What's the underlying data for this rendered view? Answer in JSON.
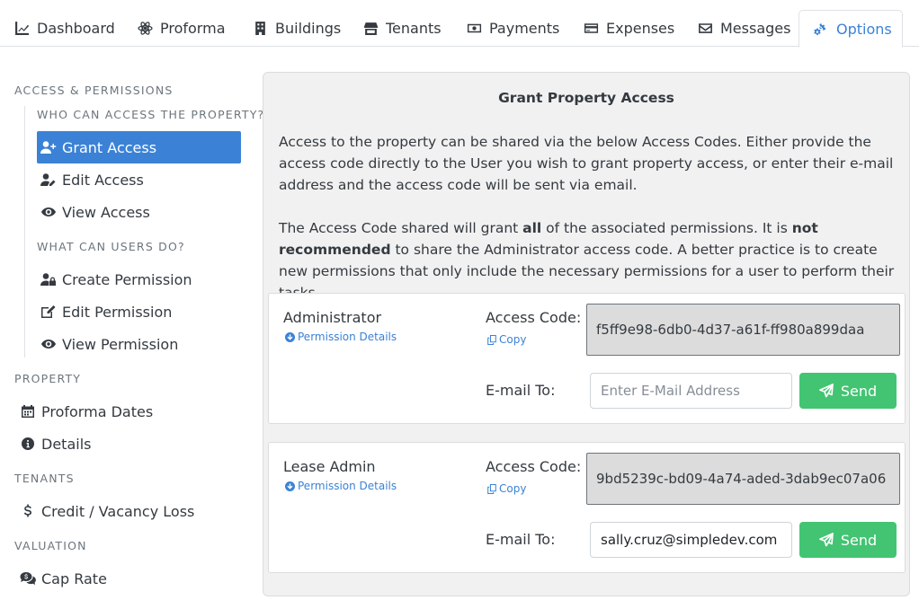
{
  "tabs": [
    {
      "label": "Dashboard",
      "icon": "chart-line-icon"
    },
    {
      "label": "Proforma",
      "icon": "atom-icon"
    },
    {
      "label": "Buildings",
      "icon": "building-icon"
    },
    {
      "label": "Tenants",
      "icon": "store-icon"
    },
    {
      "label": "Payments",
      "icon": "money-bill-icon"
    },
    {
      "label": "Expenses",
      "icon": "credit-card-icon"
    },
    {
      "label": "Messages",
      "icon": "envelope-icon"
    },
    {
      "label": "Options",
      "icon": "gears-icon",
      "active": true
    }
  ],
  "sidebar": {
    "access_heading": "ACCESS & PERMISSIONS",
    "who_heading": "WHO CAN ACCESS THE PROPERTY?",
    "grant_access": "Grant Access",
    "edit_access": "Edit Access",
    "view_access": "View Access",
    "what_heading": "WHAT CAN USERS DO?",
    "create_permission": "Create Permission",
    "edit_permission": "Edit Permission",
    "view_permission": "View Permission",
    "property_heading": "PROPERTY",
    "proforma_dates": "Proforma Dates",
    "details": "Details",
    "tenants_heading": "TENANTS",
    "credit_vacancy": "Credit / Vacancy Loss",
    "valuation_heading": "VALUATION",
    "cap_rate": "Cap Rate"
  },
  "main": {
    "title": "Grant Property Access",
    "intro": "Access to the property can be shared via the below Access Codes. Either provide the access code directly to the User you wish to grant property access, or enter their e-mail address and the access code will be sent via email.",
    "note_1": "The Access Code shared will grant ",
    "note_all": "all",
    "note_2": " of the associated permissions. It is ",
    "note_not_recommended": "not recommended",
    "note_3": " to share the Administrator access code. A better practice is to create new permissions that only include the necessary permissions for a user to perform their tasks.",
    "access_code_label": "Access Code:",
    "email_to_label": "E-mail To:",
    "permission_details": "Permission Details",
    "copy": "Copy",
    "send": "Send",
    "email_placeholder": "Enter E-Mail Address",
    "roles": [
      {
        "name": "Administrator",
        "code": "f5ff9e98-6db0-4d37-a61f-ff980a899daa",
        "email": ""
      },
      {
        "name": "Lease Admin",
        "code": "9bd5239c-bd09-4a74-aded-3dab9ec07a06",
        "email": "sally.cruz@simpledev.com"
      }
    ]
  },
  "colors": {
    "accent": "#3b82d6",
    "send_button": "#43c472",
    "panel_bg": "#f1f1f1",
    "code_box_bg": "#dcdcdc"
  }
}
